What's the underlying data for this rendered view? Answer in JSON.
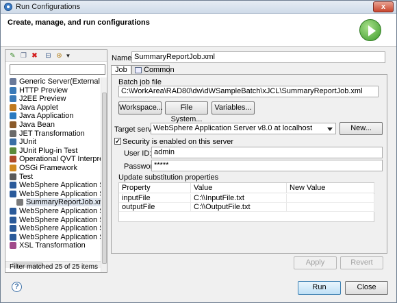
{
  "window": {
    "title": "Run Configurations",
    "close_glyph": "x"
  },
  "header": {
    "heading": "Create, manage, and run configurations",
    "icon": "run-icon"
  },
  "left": {
    "filter_value": "",
    "tree_items": [
      {
        "label": "Generic Server(External Launc",
        "icon": "server-icon"
      },
      {
        "label": "HTTP Preview",
        "icon": "browser-icon"
      },
      {
        "label": "J2EE Preview",
        "icon": "browser-icon"
      },
      {
        "label": "Java Applet",
        "icon": "applet-icon"
      },
      {
        "label": "Java Application",
        "icon": "java-app-icon"
      },
      {
        "label": "Java Bean",
        "icon": "bean-icon"
      },
      {
        "label": "JET Transformation",
        "icon": "jet-icon"
      },
      {
        "label": "JUnit",
        "icon": "junit-icon"
      },
      {
        "label": "JUnit Plug-in Test",
        "icon": "junit-plugin-icon"
      },
      {
        "label": "Operational QVT Interpreter",
        "icon": "qvt-icon"
      },
      {
        "label": "OSGi Framework",
        "icon": "osgi-icon"
      },
      {
        "label": "Test",
        "icon": "test-icon"
      },
      {
        "label": "WebSphere Application Serve",
        "icon": "websphere-icon"
      },
      {
        "label": "WebSphere Application Serve",
        "icon": "websphere-icon"
      },
      {
        "label": "SummaryReportJob.xml",
        "icon": "job-icon",
        "child": true,
        "selected": true
      },
      {
        "label": "WebSphere Application Serve",
        "icon": "websphere-icon"
      },
      {
        "label": "WebSphere Application Serve",
        "icon": "websphere-icon"
      },
      {
        "label": "WebSphere Application Serve",
        "icon": "websphere-icon"
      },
      {
        "label": "WebSphere Application Serve",
        "icon": "websphere-icon"
      },
      {
        "label": "XSL Transformation",
        "icon": "xsl-icon"
      }
    ],
    "filter_status": "Filter matched 25 of 25 items"
  },
  "main": {
    "name_label": "Name:",
    "name_value": "SummaryReportJob.xml",
    "tabs": [
      {
        "label": "Job",
        "active": true
      },
      {
        "label": "Common",
        "active": false
      }
    ],
    "batch_job_label": "Batch job file",
    "batch_job_path": "C:\\WorkArea\\RAD80\\dw\\dWSampleBatch\\xJCL\\SummaryReportJob.xml",
    "workspace_button": "Workspace...",
    "filesystem_button": "File System...",
    "variables_button": "Variables...",
    "target_server_label": "Target server:",
    "target_server_value": "WebSphere Application Server v8.0 at localhost",
    "new_button": "New...",
    "security_checkbox_label": "Security is enabled on this server",
    "security_checked": true,
    "userid_label": "User ID:",
    "userid_value": "admin",
    "password_label": "Password:",
    "password_value": "*****",
    "subs_label": "Update substitution properties",
    "table_headers": [
      "Property",
      "Value",
      "New Value"
    ],
    "table_rows": [
      [
        "inputFile",
        "C:\\\\InputFile.txt",
        ""
      ],
      [
        "outputFile",
        "C:\\\\OutputFile.txt",
        ""
      ]
    ],
    "apply_button": "Apply",
    "revert_button": "Revert"
  },
  "footer": {
    "help_glyph": "?",
    "run_button": "Run",
    "close_button": "Close"
  }
}
